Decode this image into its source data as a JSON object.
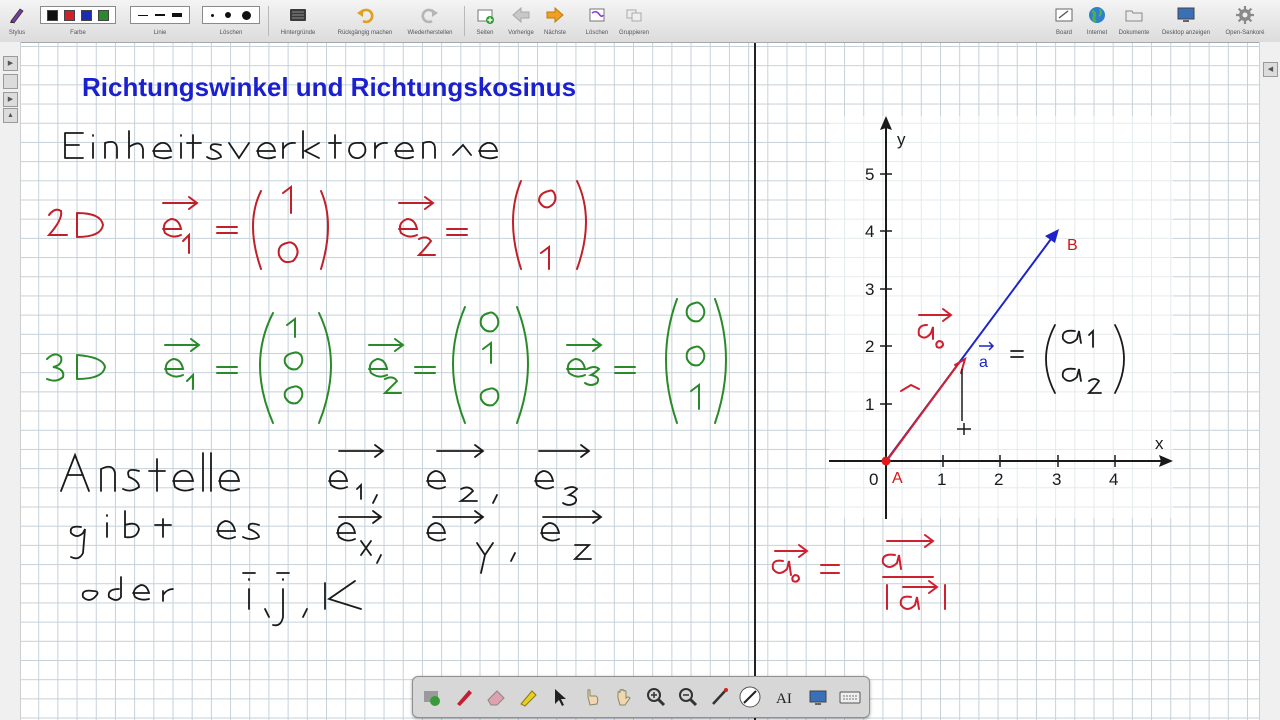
{
  "toolbar": {
    "groups": {
      "stylus": "Stylus",
      "farbe": "Farbe",
      "linie": "Linie",
      "loeschen": "Löschen",
      "hintergruende": "Hintergründe",
      "undo": "Rückgängig machen",
      "redo": "Wiederherstellen",
      "seiten": "Seiten",
      "vorherige": "Vorherige",
      "naechste": "Nächste",
      "loeschen2": "Löschen",
      "gruppieren": "Gruppieren",
      "board": "Board",
      "internet": "Internet",
      "dokumente": "Dokumente",
      "desktop": "Desktop anzeigen",
      "opensankore": "Open-Sankoré"
    },
    "colors": [
      "#111111",
      "#d0202a",
      "#1d2bb0",
      "#2a8a2a"
    ]
  },
  "board": {
    "title": "Richtungswinkel und Richtungskosinus",
    "title_color": "#1a1fd0",
    "plot": {
      "x_label": "x",
      "y_label": "y",
      "x_ticks": [
        "0",
        "1",
        "2",
        "3",
        "4"
      ],
      "y_ticks": [
        "1",
        "2",
        "3",
        "4",
        "5"
      ],
      "point_a_label": "A",
      "point_b_label": "B",
      "vector_label": "a",
      "vector_color": "#1d24c8",
      "point_color": "#e01818"
    }
  },
  "palette": {
    "tools": [
      "podcast-tool",
      "pen-tool",
      "eraser-tool",
      "marker-tool",
      "selector-tool",
      "play-tool",
      "hand-tool",
      "zoom-in-tool",
      "zoom-out-tool",
      "pointer-tool",
      "line-tool",
      "text-tool",
      "capture-tool",
      "keyboard-tool"
    ]
  }
}
